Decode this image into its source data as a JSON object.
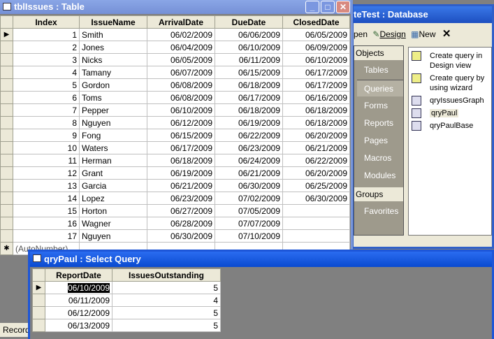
{
  "table_window": {
    "title": "tblIssues : Table",
    "columns": [
      "Index",
      "IssueName",
      "ArrivalDate",
      "DueDate",
      "ClosedDate"
    ],
    "rows": [
      [
        "1",
        "Smith",
        "06/02/2009",
        "06/06/2009",
        "06/05/2009"
      ],
      [
        "2",
        "Jones",
        "06/04/2009",
        "06/10/2009",
        "06/09/2009"
      ],
      [
        "3",
        "Nicks",
        "06/05/2009",
        "06/11/2009",
        "06/10/2009"
      ],
      [
        "4",
        "Tamany",
        "06/07/2009",
        "06/15/2009",
        "06/17/2009"
      ],
      [
        "5",
        "Gordon",
        "06/08/2009",
        "06/18/2009",
        "06/17/2009"
      ],
      [
        "6",
        "Toms",
        "06/08/2009",
        "06/17/2009",
        "06/16/2009"
      ],
      [
        "7",
        "Pepper",
        "06/10/2009",
        "06/18/2009",
        "06/18/2009"
      ],
      [
        "8",
        "Nguyen",
        "06/12/2009",
        "06/19/2009",
        "06/18/2009"
      ],
      [
        "9",
        "Fong",
        "06/15/2009",
        "06/22/2009",
        "06/20/2009"
      ],
      [
        "10",
        "Waters",
        "06/17/2009",
        "06/23/2009",
        "06/21/2009"
      ],
      [
        "11",
        "Herman",
        "06/18/2009",
        "06/24/2009",
        "06/22/2009"
      ],
      [
        "12",
        "Grant",
        "06/19/2009",
        "06/21/2009",
        "06/20/2009"
      ],
      [
        "13",
        "Garcia",
        "06/21/2009",
        "06/30/2009",
        "06/25/2009"
      ],
      [
        "14",
        "Lopez",
        "06/23/2009",
        "07/02/2009",
        "06/30/2009"
      ],
      [
        "15",
        "Horton",
        "06/27/2009",
        "07/05/2009",
        ""
      ],
      [
        "16",
        "Wagner",
        "06/28/2009",
        "07/07/2009",
        ""
      ],
      [
        "17",
        "Nguyen",
        "06/30/2009",
        "07/10/2009",
        ""
      ]
    ],
    "new_row": "(AutoNumber)",
    "record_label": "Record"
  },
  "db_window": {
    "title": "teTest : Database",
    "toolbar": {
      "open": "pen",
      "design": "Design",
      "new": "New",
      "delete": "✕"
    },
    "objects_header": "Objects",
    "objects": [
      "Tables",
      "Queries",
      "Forms",
      "Reports",
      "Pages",
      "Macros",
      "Modules"
    ],
    "selected_object": "Queries",
    "groups_header": "Groups",
    "groups": [
      "Favorites"
    ],
    "items": [
      "Create query in Design view",
      "Create query by using wizard",
      "qryIssuesGraph",
      "qryPaul",
      "qryPaulBase"
    ],
    "selected_item": "qryPaul"
  },
  "query_window": {
    "title": "qryPaul : Select Query",
    "columns": [
      "ReportDate",
      "IssuesOutstanding"
    ],
    "rows": [
      [
        "06/10/2009",
        "5"
      ],
      [
        "06/11/2009",
        "4"
      ],
      [
        "06/12/2009",
        "5"
      ],
      [
        "06/13/2009",
        "5"
      ]
    ]
  }
}
